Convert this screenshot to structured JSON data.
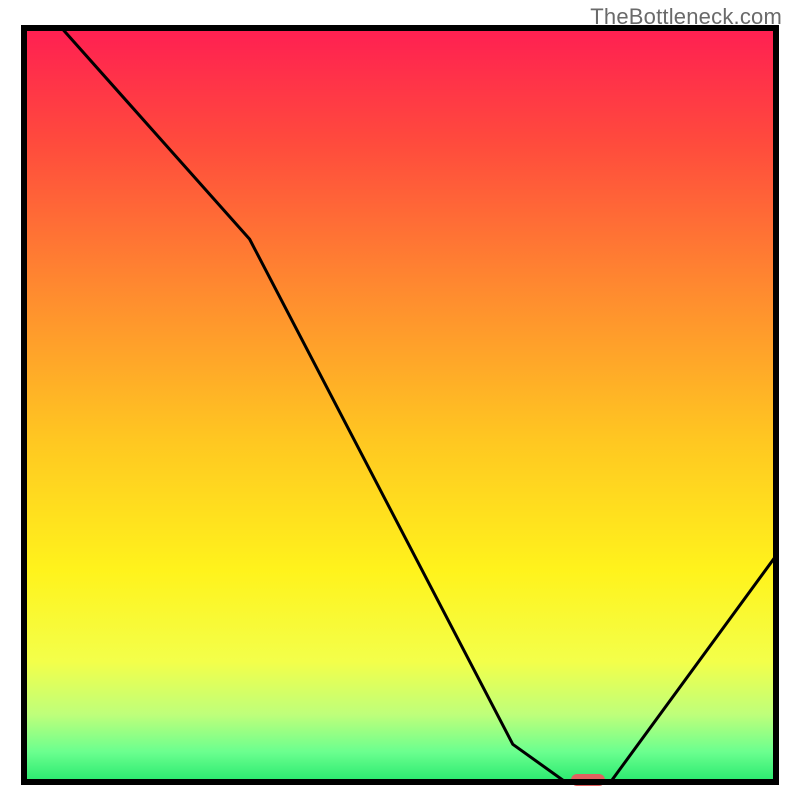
{
  "watermark": "TheBottleneck.com",
  "chart_data": {
    "type": "line",
    "title": "",
    "xlabel": "",
    "ylabel": "",
    "xlim": [
      0,
      100
    ],
    "ylim": [
      0,
      100
    ],
    "x": [
      5,
      30,
      65,
      72,
      78,
      100
    ],
    "values": [
      100,
      72,
      5,
      0,
      0,
      30
    ],
    "marker": {
      "x": 75,
      "y": 0
    },
    "gradient_stops": [
      {
        "offset": 0.0,
        "color": "#ff1f52"
      },
      {
        "offset": 0.15,
        "color": "#ff4a3d"
      },
      {
        "offset": 0.35,
        "color": "#ff8b2f"
      },
      {
        "offset": 0.55,
        "color": "#ffc821"
      },
      {
        "offset": 0.72,
        "color": "#fff31c"
      },
      {
        "offset": 0.84,
        "color": "#f3ff4a"
      },
      {
        "offset": 0.91,
        "color": "#bfff7a"
      },
      {
        "offset": 0.96,
        "color": "#6bff8f"
      },
      {
        "offset": 1.0,
        "color": "#28e96e"
      }
    ]
  }
}
